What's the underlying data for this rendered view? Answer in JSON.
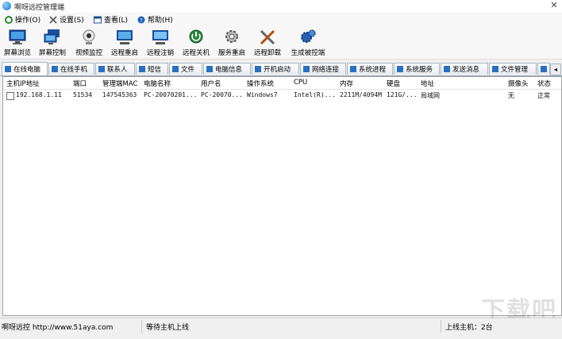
{
  "window": {
    "title": "啊呀远控管理端",
    "close_glyph": "✕"
  },
  "menu": [
    {
      "label": "操作(O)",
      "icon": "refresh-icon"
    },
    {
      "label": "设置(S)",
      "icon": "tools-icon"
    },
    {
      "label": "查看(L)",
      "icon": "view-icon"
    },
    {
      "label": "帮助(H)",
      "icon": "help-icon"
    }
  ],
  "toolbar": [
    {
      "label": "屏幕浏览",
      "icon": "monitor-icon"
    },
    {
      "label": "屏幕控制",
      "icon": "screen-control-icon"
    },
    {
      "label": "视频监控",
      "icon": "webcam-icon"
    },
    {
      "label": "远程重启",
      "icon": "restart-icon"
    },
    {
      "label": "远程注销",
      "icon": "logoff-icon"
    },
    {
      "label": "远程关机",
      "icon": "shutdown-icon"
    },
    {
      "label": "服务重启",
      "icon": "gear-icon"
    },
    {
      "label": "远程卸载",
      "icon": "uninstall-icon"
    },
    {
      "label": "生成被控端",
      "icon": "build-icon"
    }
  ],
  "tabs": [
    "在线电脑",
    "在线手机",
    "联系人",
    "短信",
    "文件",
    "电脑信息",
    "开机启动",
    "网络连接",
    "系统进程",
    "系统服务",
    "发送消息",
    "文件管理"
  ],
  "tab_scroll_glyph": "◂",
  "table": {
    "columns": [
      "主机IP地址",
      "端口",
      "管理端MAC",
      "电脑名称",
      "用户名",
      "操作系统",
      "CPU",
      "内存",
      "硬盘",
      "地址",
      "摄像头",
      "状态"
    ],
    "rows": [
      [
        "192.168.1.11",
        "51534",
        "147545363",
        "PC-20070201...",
        "PC-20070...",
        "Windows7",
        "Intel(R)...",
        "2211M/4094M",
        "121G/...",
        "局域网",
        "无",
        "正常"
      ]
    ]
  },
  "status": {
    "site": "啊呀远控 http://www.51aya.com",
    "message": "等待主机上线",
    "online": "上线主机：2台"
  },
  "watermark": "下载吧",
  "colors": {
    "accent": "#2a6fc4",
    "window_bg": "#f0f0f0",
    "panel_border": "#a0a0a0"
  }
}
